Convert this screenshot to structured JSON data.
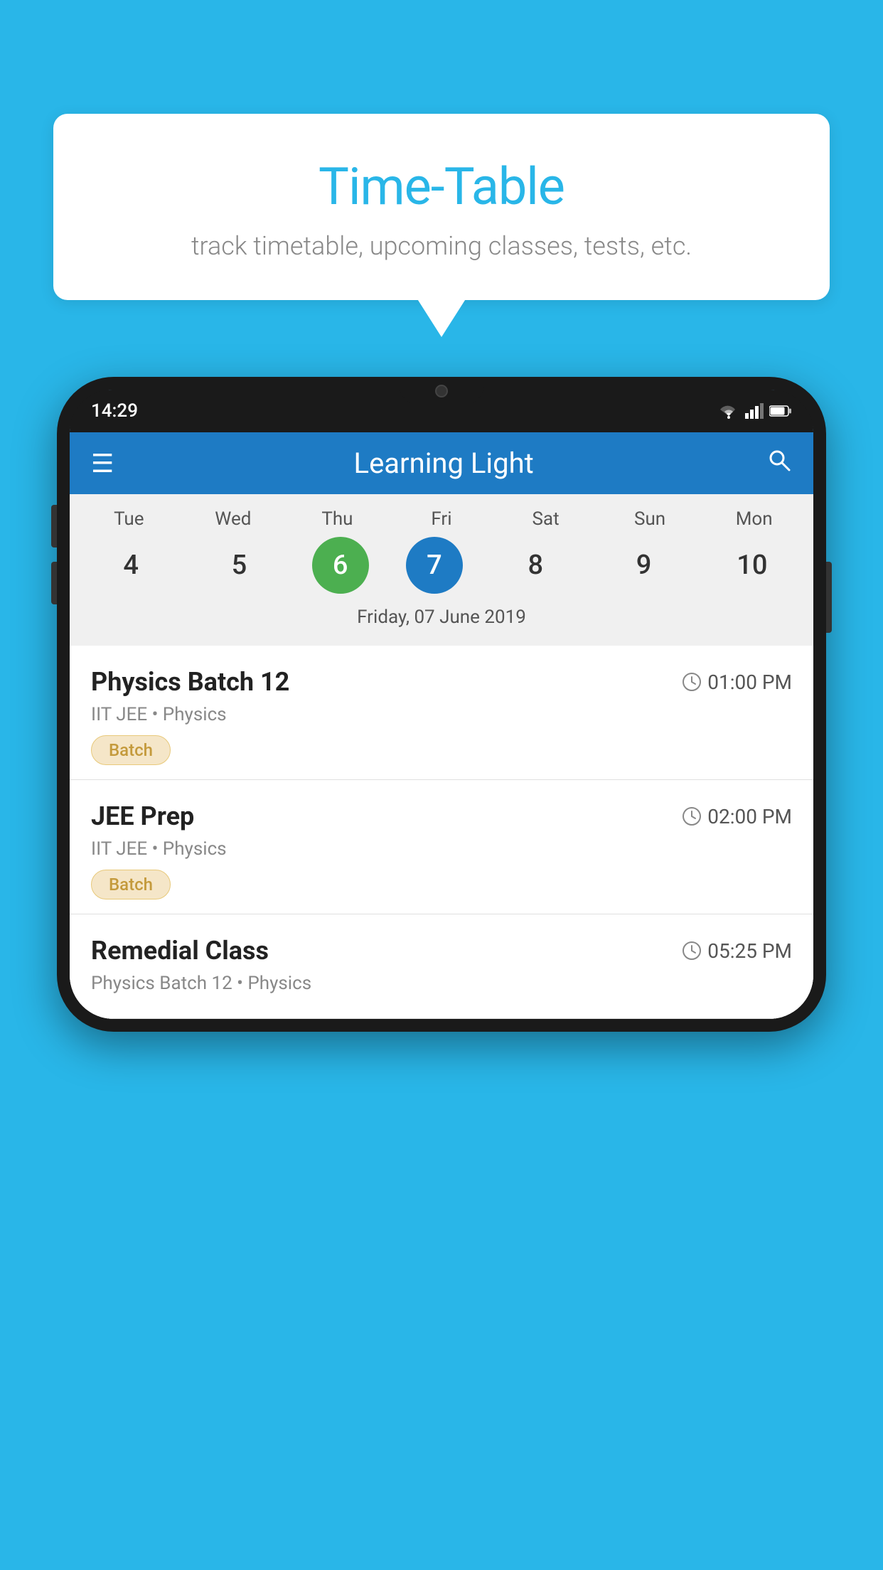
{
  "background_color": "#29B6E8",
  "bubble": {
    "title": "Time-Table",
    "subtitle": "track timetable, upcoming classes, tests, etc."
  },
  "phone": {
    "status_time": "14:29",
    "app_name": "Learning Light",
    "calendar": {
      "days": [
        {
          "label": "Tue",
          "number": "4"
        },
        {
          "label": "Wed",
          "number": "5"
        },
        {
          "label": "Thu",
          "number": "6",
          "state": "today"
        },
        {
          "label": "Fri",
          "number": "7",
          "state": "selected"
        },
        {
          "label": "Sat",
          "number": "8"
        },
        {
          "label": "Sun",
          "number": "9"
        },
        {
          "label": "Mon",
          "number": "10"
        }
      ],
      "selected_date": "Friday, 07 June 2019"
    },
    "schedule": [
      {
        "title": "Physics Batch 12",
        "time": "01:00 PM",
        "subtitle": "IIT JEE • Physics",
        "badge": "Batch"
      },
      {
        "title": "JEE Prep",
        "time": "02:00 PM",
        "subtitle": "IIT JEE • Physics",
        "badge": "Batch"
      },
      {
        "title": "Remedial Class",
        "time": "05:25 PM",
        "subtitle": "Physics Batch 12 • Physics",
        "badge": null
      }
    ]
  },
  "icons": {
    "hamburger": "☰",
    "search": "🔍",
    "clock": "🕐"
  }
}
